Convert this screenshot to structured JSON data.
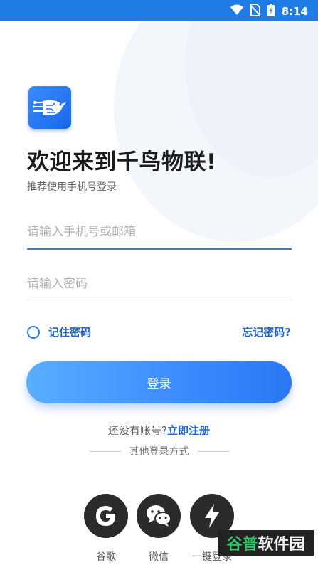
{
  "status_bar": {
    "time": "8:14",
    "icons": [
      "wifi-icon",
      "no-sim-icon",
      "battery-charging-icon"
    ]
  },
  "colors": {
    "accent": "#1f66cc",
    "status_bar": "#1f7be6",
    "button_start": "#5aaeff",
    "button_end": "#2a78f5"
  },
  "header": {
    "title": "欢迎来到千鸟物联!",
    "subtitle": "推荐使用手机号登录"
  },
  "form": {
    "phone_placeholder": "请输入手机号或邮箱",
    "phone_value": "",
    "password_placeholder": "请输入密码",
    "password_value": "",
    "remember_label": "记住密码",
    "forgot_label": "忘记密码?",
    "login_label": "登录"
  },
  "register": {
    "prompt": "还没有账号?",
    "link": "立即注册"
  },
  "other_login": {
    "label": "其他登录方式",
    "options": [
      {
        "icon": "google-icon",
        "label": "谷歌"
      },
      {
        "icon": "wechat-icon",
        "label": "微信"
      },
      {
        "icon": "lightning-icon",
        "label": "一键登录"
      }
    ]
  },
  "watermark": {
    "part1": "谷普",
    "part2": "软件园"
  }
}
